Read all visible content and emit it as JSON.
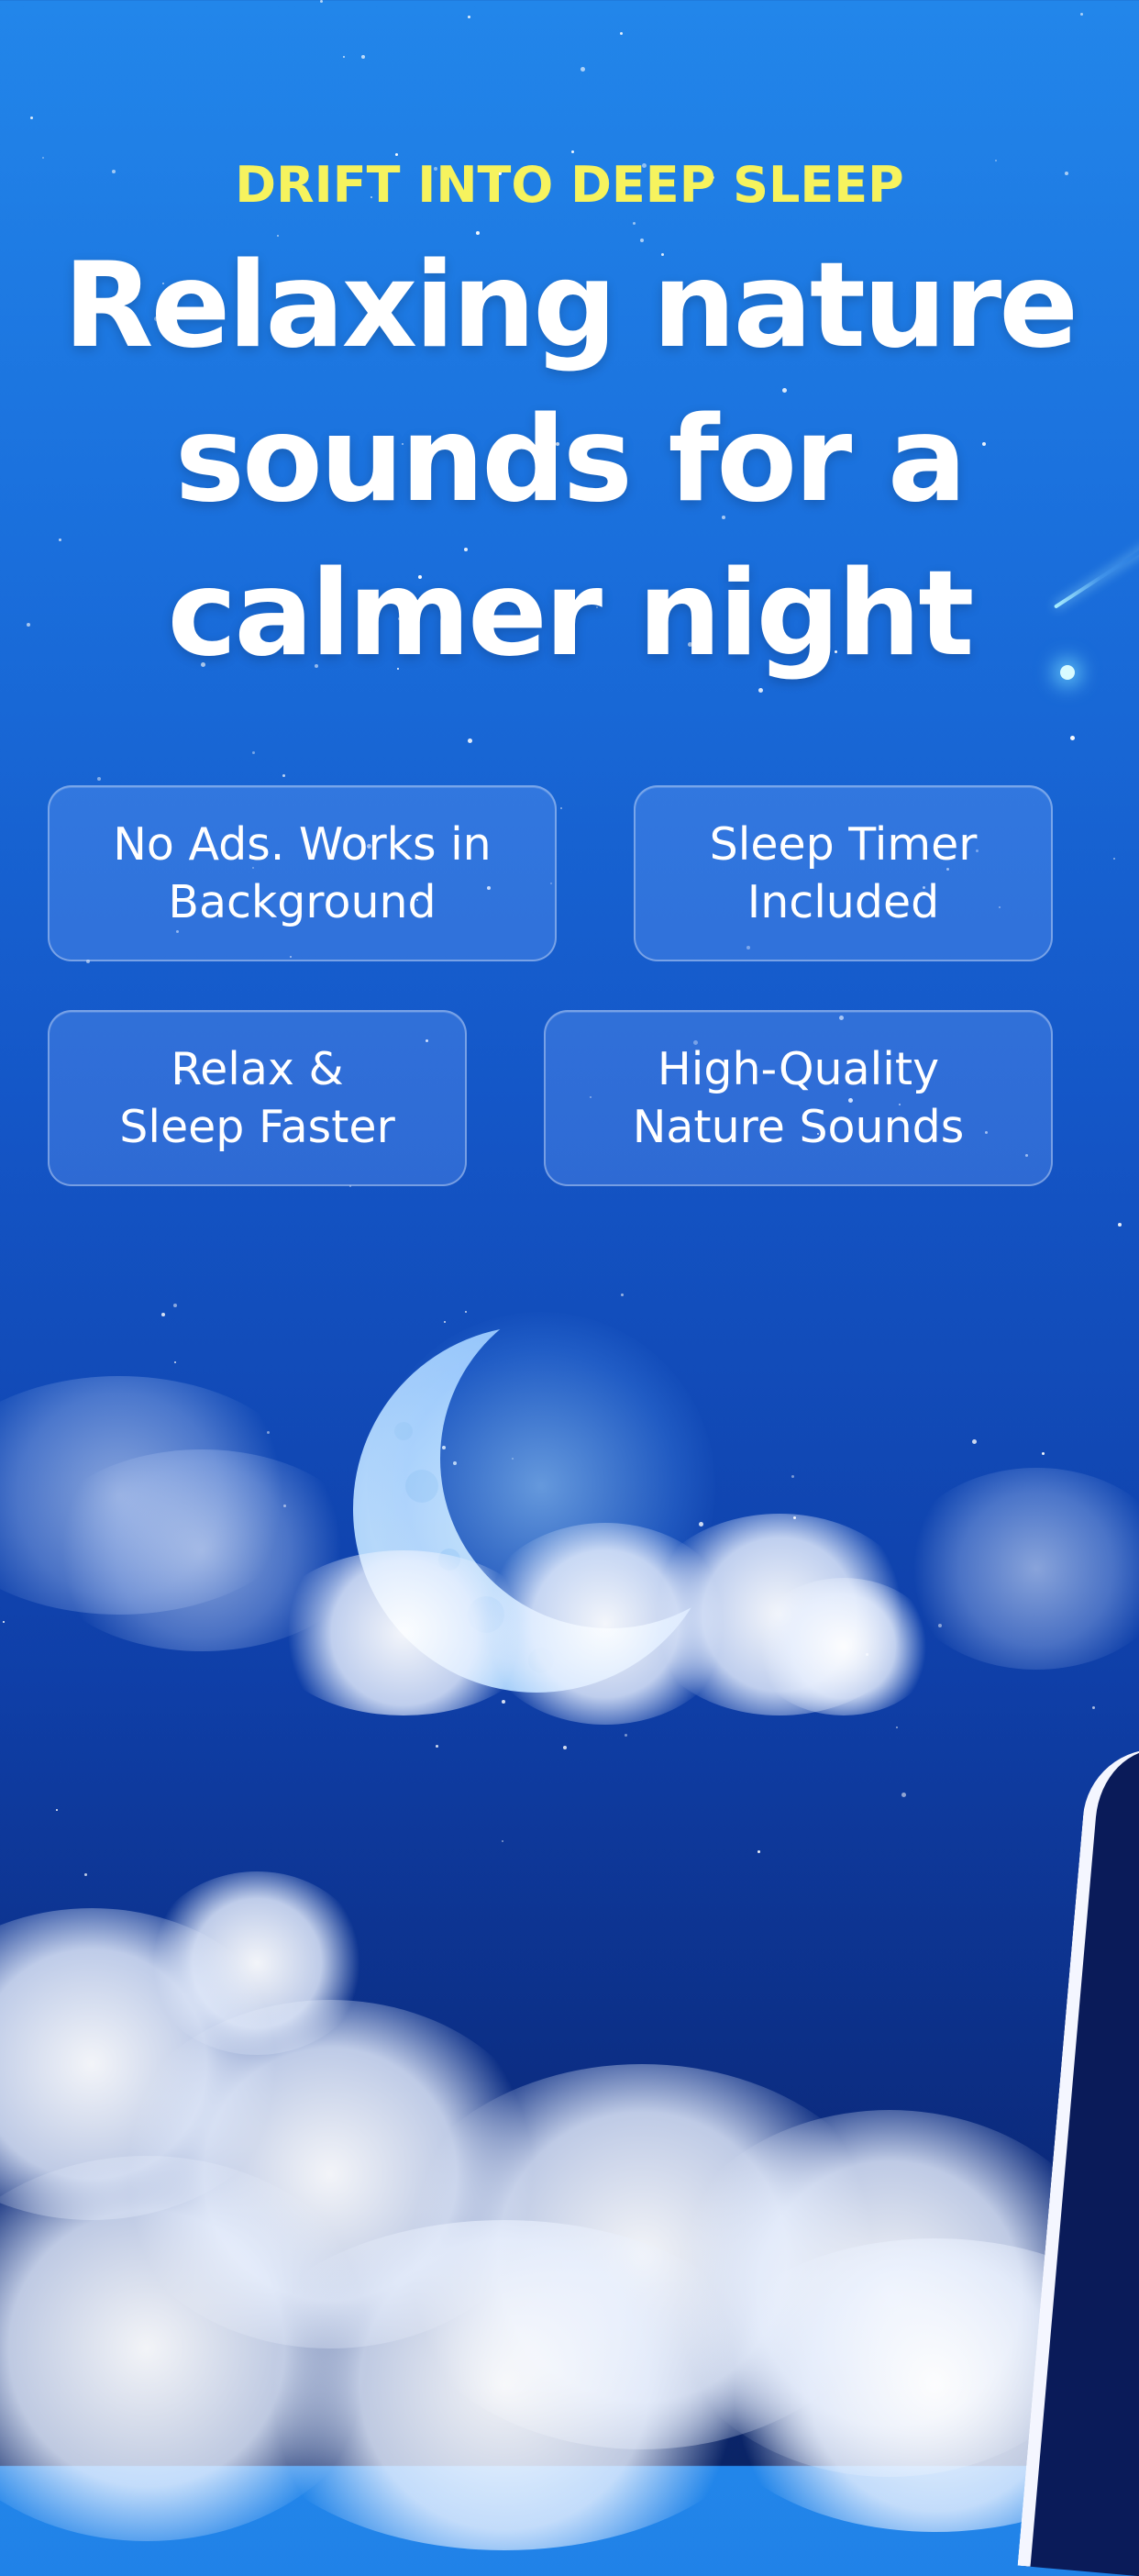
{
  "eyebrow": "DRIFT INTO DEEP SLEEP",
  "headline": "Relaxing nature sounds for a calmer night",
  "features": [
    {
      "label": "No Ads. Works in\nBackground"
    },
    {
      "label": "Sleep Timer\nIncluded"
    },
    {
      "label": "Relax &\nSleep Faster"
    },
    {
      "label": "High-Quality\nNature Sounds"
    }
  ],
  "colors": {
    "eyebrow": "#f6f35e",
    "headline": "#ffffff",
    "sky_top": "#2286ea",
    "sky_bottom": "#0a2466"
  },
  "icons": [
    "crescent-moon-icon",
    "shooting-star-icon"
  ]
}
